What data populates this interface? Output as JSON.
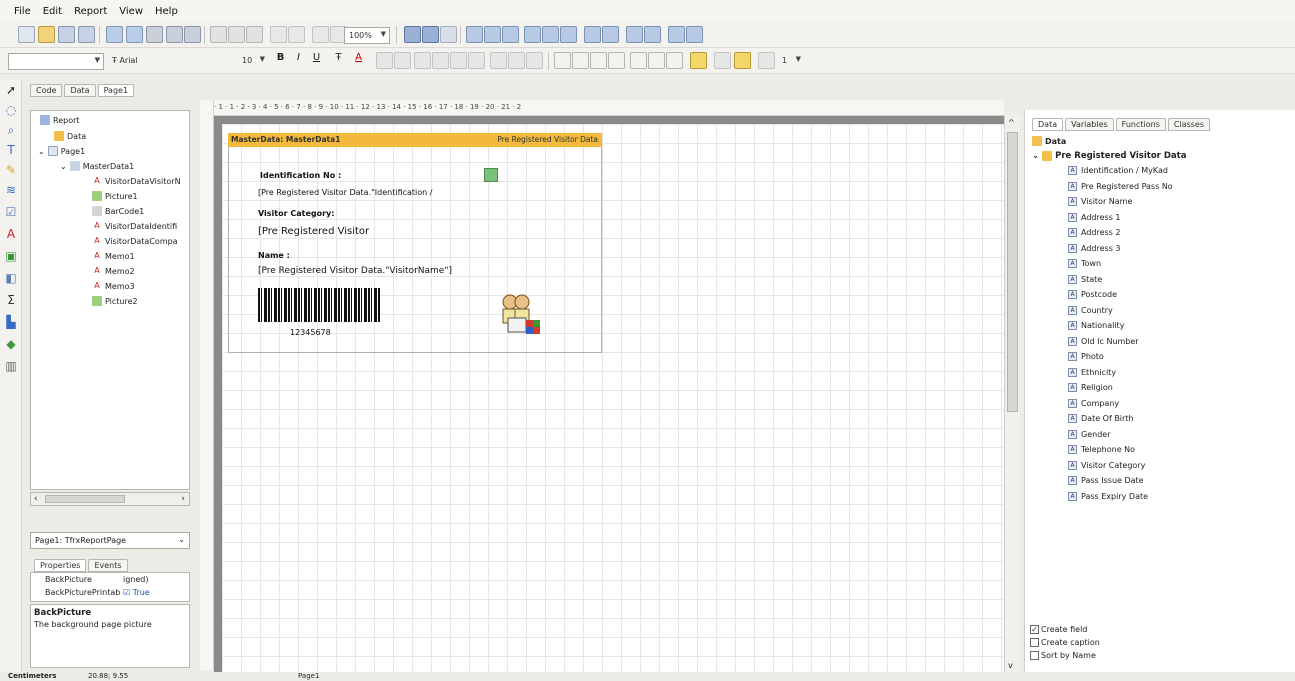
{
  "menu": [
    "File",
    "Edit",
    "Report",
    "View",
    "Help"
  ],
  "toolbar": {
    "zoom": "100%",
    "font_name": "Arial",
    "font_size": "10",
    "frame_width": "1"
  },
  "designer_tabs": [
    "Code",
    "Data",
    "Page1"
  ],
  "tree": {
    "report": "Report",
    "data": "Data",
    "page1": "Page1",
    "masterdata": "MasterData1",
    "children": [
      "VisitorDataVisitorN",
      "Picture1",
      "BarCode1",
      "VisitorDataIdentifi",
      "VisitorDataCompa",
      "Memo1",
      "Memo2",
      "Memo3",
      "Picture2"
    ]
  },
  "page_combo": "Page1: TfrxReportPage",
  "inspector": {
    "tabs": [
      "Properties",
      "Events"
    ],
    "rows": [
      {
        "name": "BackPicture",
        "value": "igned)"
      },
      {
        "name": "BackPicturePrintab",
        "value": "True"
      }
    ],
    "desc_title": "BackPicture",
    "desc_text": "The background page picture"
  },
  "ruler": "· 1 · 1 · 2 · 3 · 4 · 5 · 6 · 7 · 8 · 9 · 10 · 11 · 12 · 13 · 14 · 15 · 16 · 17 · 18 · 19 · 20 · 21 · 2",
  "band": {
    "title": "MasterData: MasterData1",
    "source": "Pre Registered Visitor Data",
    "id_label": "Identification No :",
    "id_value": "[Pre Registered Visitor Data.\"Identification /",
    "cat_label": "Visitor Category:",
    "cat_value": "[Pre Registered Visitor",
    "name_label": "Name :",
    "name_value": "[Pre Registered Visitor Data.\"VisitorName\"]",
    "barcode_text": "12345678"
  },
  "right": {
    "tabs": [
      "Data",
      "Variables",
      "Functions",
      "Classes"
    ],
    "root": "Data",
    "dataset": "Pre Registered Visitor Data",
    "fields": [
      "Identification / MyKad",
      "Pre Registered Pass No",
      "Visitor Name",
      "Address 1",
      "Address 2",
      "Address 3",
      "Town",
      "State",
      "Postcode",
      "Country",
      "Nationality",
      "Old Ic Number",
      "Photo",
      "Ethnicity",
      "Religion",
      "Company",
      "Date Of Birth",
      "Gender",
      "Telephone No",
      "Visitor Category",
      "Pass Issue Date",
      "Pass Expiry Date"
    ],
    "checks": [
      {
        "label": "Create field",
        "checked": true
      },
      {
        "label": "Create caption",
        "checked": false
      },
      {
        "label": "Sort by Name",
        "checked": false
      }
    ]
  },
  "status": {
    "units": "Centimeters",
    "coords": "20.88; 9.55",
    "page": "Page1"
  }
}
